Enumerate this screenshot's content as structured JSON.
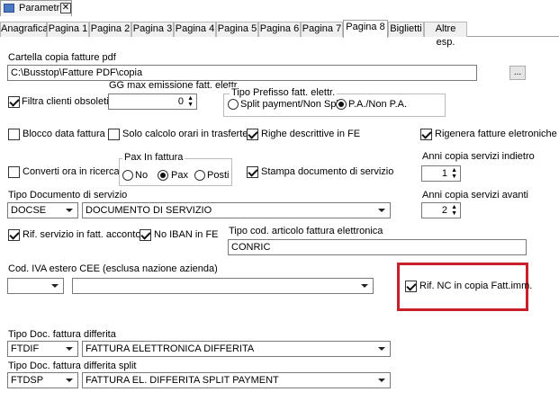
{
  "window_tab": {
    "title": "Parametri",
    "close": "✕"
  },
  "tabs": [
    "Anagrafica",
    "Pagina 1",
    "Pagina 2",
    "Pagina 3",
    "Pagina 4",
    "Pagina 5",
    "Pagina 6",
    "Pagina 7",
    "Pagina 8",
    "Biglietti",
    "Altre esp."
  ],
  "active_tab": "Pagina 8",
  "cartella": {
    "label": "Cartella copia fatture pdf",
    "value": "C:\\Busstop\\Fatture PDF\\copia",
    "browse": "..."
  },
  "gg_max": {
    "label": "GG max emissione fatt. elettr.",
    "value": "0"
  },
  "tipo_prefisso": {
    "label": "Tipo Prefisso fatt. elettr.",
    "options": [
      "Split payment/Non Split",
      "P.A./Non P.A."
    ],
    "selected": "P.A./Non P.A."
  },
  "filtra_clienti": {
    "label": "Filtra clienti obsoleti",
    "checked": true
  },
  "blocco_data": {
    "label": "Blocco data fattura",
    "checked": false
  },
  "solo_calcolo": {
    "label": "Solo calcolo orari in trasferte",
    "checked": false
  },
  "righe_descrittive": {
    "label": "Righe descrittive in FE",
    "checked": true
  },
  "rigenera": {
    "label": "Rigenera fatture eletroniche",
    "checked": true
  },
  "converti_ora": {
    "label": "Converti ora in ricerca",
    "checked": false
  },
  "pax": {
    "label": "Pax In fattura",
    "options": [
      "No",
      "Pax",
      "Posti"
    ],
    "selected": "Pax"
  },
  "stampa_doc": {
    "label": "Stampa documento di servizio",
    "checked": true
  },
  "anni_indietro": {
    "label": "Anni copia servizi indietro",
    "value": "1"
  },
  "tipo_doc_servizio": {
    "label": "Tipo Documento di servizio",
    "code": "DOCSE",
    "description": "DOCUMENTO DI SERVIZIO"
  },
  "anni_avanti": {
    "label": "Anni copia servizi avanti",
    "value": "2"
  },
  "rif_servizio": {
    "label": "Rif. servizio in fatt. acconto",
    "checked": true
  },
  "no_iban": {
    "label": "No IBAN in FE",
    "checked": true
  },
  "tipo_cod_articolo": {
    "label": "Tipo cod. articolo fattura elettronica",
    "value": "CONRIC"
  },
  "cod_iva": {
    "label": "Cod. IVA estero CEE (esclusa nazione azienda)",
    "code": "",
    "description": ""
  },
  "rif_nc": {
    "label": "Rif. NC in copia Fatt.imm.",
    "checked": true
  },
  "tipo_doc_differita": {
    "label": "Tipo Doc. fattura differita",
    "code": "FTDIF",
    "description": "FATTURA ELETTRONICA DIFFERITA"
  },
  "tipo_doc_differita_split": {
    "label": "Tipo Doc. fattura differita split",
    "code": "FTDSP",
    "description": "FATTURA EL. DIFFERITA SPLIT PAYMENT"
  },
  "colors": {
    "highlight": "#c8202a"
  }
}
